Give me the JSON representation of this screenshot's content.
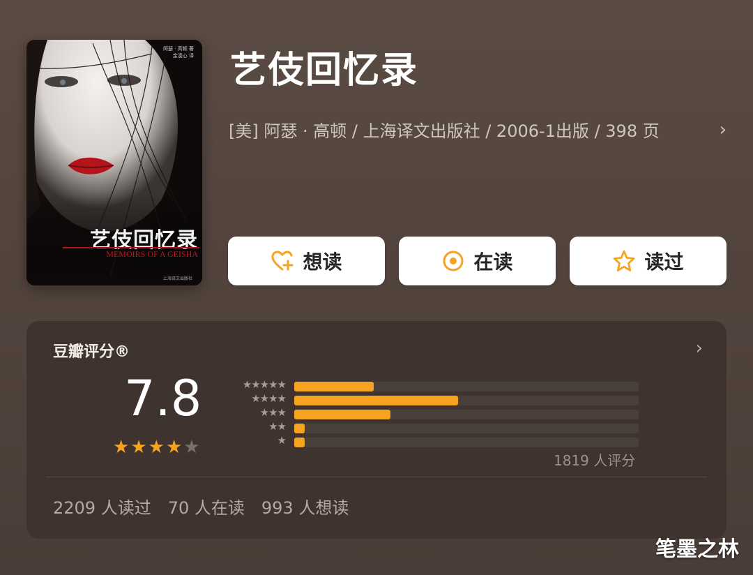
{
  "book": {
    "title": "艺伎回忆录",
    "meta": "[美] 阿瑟 · 高顿 / 上海译文出版社 / 2006-1出版 / 398 页",
    "cover": {
      "small_text": "阿瑟 · 高顿 著\n 金凌心 译",
      "title": "艺伎回忆录",
      "subtitle": "MEMOIRS OF A GEISHA",
      "publisher_mark": "上海译文出版社"
    }
  },
  "actions": [
    {
      "label": "想读",
      "icon": "heart-plus-icon"
    },
    {
      "label": "在读",
      "icon": "target-icon"
    },
    {
      "label": "读过",
      "icon": "star-outline-icon"
    }
  ],
  "rating": {
    "label": "豆瓣评分®",
    "score": "7.8",
    "stars": 4,
    "max_stars": 5,
    "distribution": [
      {
        "stars": 5,
        "fraction": 0.23
      },
      {
        "stars": 4,
        "fraction": 0.475
      },
      {
        "stars": 3,
        "fraction": 0.28
      },
      {
        "stars": 2,
        "fraction": 0.03
      },
      {
        "stars": 1,
        "fraction": 0.03
      }
    ],
    "count_text": "1819 人评分"
  },
  "stats": [
    "2209 人读过",
    "70 人在读",
    "993 人想读"
  ],
  "watermark": "笔墨之林",
  "colors": {
    "accent": "#f5a321",
    "background": "#52443d",
    "panel": "#3e332f"
  }
}
